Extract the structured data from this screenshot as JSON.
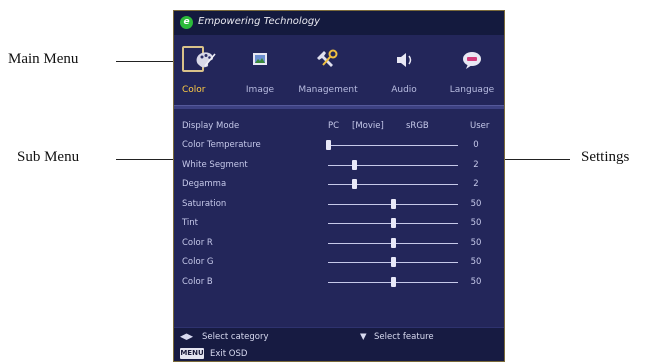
{
  "callouts": {
    "left_top": "Main Menu",
    "left_bottom": "Sub Menu",
    "right": "Settings"
  },
  "osd": {
    "brand": "Empowering Technology",
    "brand_logo": "e",
    "tabs": [
      {
        "label": "Color",
        "icon": "palette-icon",
        "active": true
      },
      {
        "label": "Image",
        "icon": "picture-icon",
        "active": false
      },
      {
        "label": "Management",
        "icon": "tools-icon",
        "active": false
      },
      {
        "label": "Audio",
        "icon": "speaker-icon",
        "active": false
      },
      {
        "label": "Language",
        "icon": "speech-bubble-icon",
        "active": false
      }
    ],
    "display_mode": {
      "label": "Display Mode",
      "options": [
        "PC",
        "[Movie]",
        "sRGB",
        "User"
      ],
      "selected": "Movie"
    },
    "sliders": [
      {
        "label": "Color Temperature",
        "value": "0",
        "level": 0.0
      },
      {
        "label": "White Segment",
        "value": "2",
        "level": 0.2
      },
      {
        "label": "Degamma",
        "value": "2",
        "level": 0.2
      },
      {
        "label": "Saturation",
        "value": "50",
        "level": 0.5
      },
      {
        "label": "Tint",
        "value": "50",
        "level": 0.5
      },
      {
        "label": "Color R",
        "value": "50",
        "level": 0.5
      },
      {
        "label": "Color G",
        "value": "50",
        "level": 0.5
      },
      {
        "label": "Color B",
        "value": "50",
        "level": 0.5
      }
    ],
    "footer": {
      "select_category": "Select category",
      "select_feature": "Select feature",
      "menu_key": "MENU",
      "exit": "Exit OSD"
    }
  }
}
